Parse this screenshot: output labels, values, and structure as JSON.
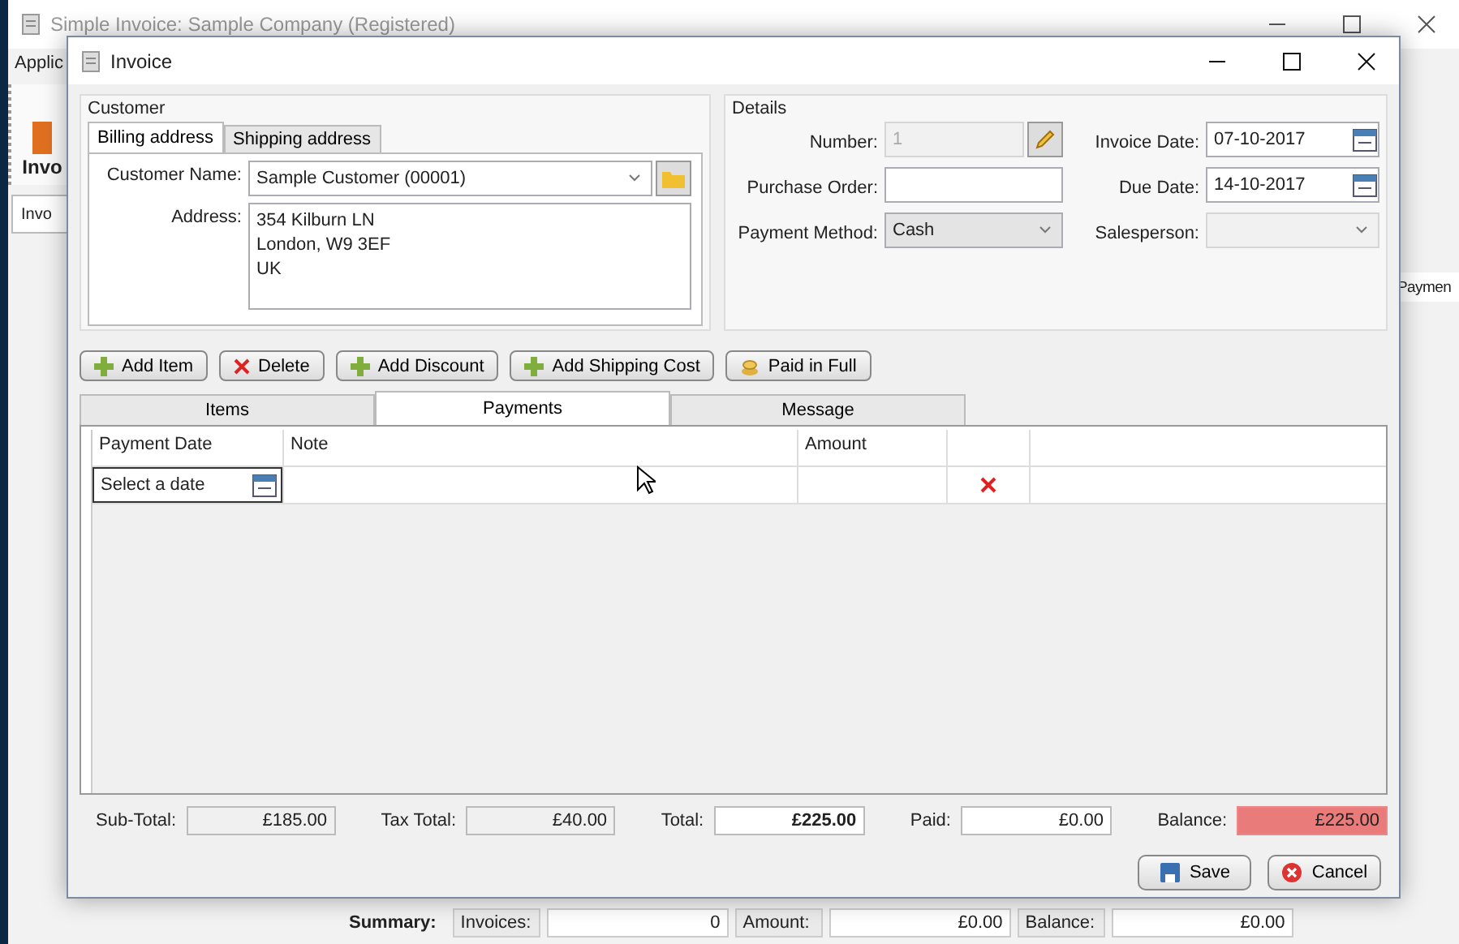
{
  "main_window": {
    "title": "Simple Invoice: Sample Company (Registered)",
    "menu": [
      "Applic"
    ],
    "ribbon_label": "Invo",
    "tab_label": "Invo",
    "side_header": "Paymen",
    "summary": [
      {
        "kind": "heading",
        "text": "Summary:"
      },
      {
        "kind": "label",
        "text": "Invoices:"
      },
      {
        "kind": "value",
        "text": "0"
      },
      {
        "kind": "label",
        "text": "Amount:"
      },
      {
        "kind": "value",
        "text": "£0.00"
      },
      {
        "kind": "label",
        "text": "Balance:"
      },
      {
        "kind": "value",
        "text": "£0.00"
      }
    ]
  },
  "dialog": {
    "title": "Invoice"
  },
  "customer": {
    "title": "Customer",
    "tabs": [
      {
        "label": "Billing address",
        "selected": true
      },
      {
        "label": "Shipping address",
        "selected": false
      }
    ],
    "name_label": "Customer Name:",
    "name_value": "Sample Customer (00001)",
    "address_label": "Address:",
    "address_lines": [
      "354 Kilburn LN",
      "London, W9 3EF",
      "UK"
    ]
  },
  "details": {
    "title": "Details",
    "fields": [
      {
        "label": "Number:",
        "kind": "number",
        "value": "1",
        "disabled": true
      },
      {
        "label": "Invoice Date:",
        "kind": "date",
        "value": "07-10-2017",
        "disabled": false
      },
      {
        "label": "Purchase Order:",
        "kind": "text",
        "disabled": false
      },
      {
        "label": "Due Date:",
        "kind": "date",
        "value": "14-10-2017",
        "disabled": false
      },
      {
        "label": "Payment Method:",
        "kind": "select",
        "value": "Cash",
        "disabled": false
      },
      {
        "label": "Salesperson:",
        "kind": "select",
        "disabled": true
      }
    ]
  },
  "toolbar": [
    {
      "label": "Add Item",
      "kind": "add"
    },
    {
      "label": "Delete",
      "kind": "delete"
    },
    {
      "label": "Add Discount",
      "kind": "add"
    },
    {
      "label": "Add Shipping Cost",
      "kind": "add"
    },
    {
      "label": "Paid in Full",
      "kind": "paid"
    }
  ],
  "tabs": [
    {
      "label": "Items",
      "selected": false
    },
    {
      "label": "Payments",
      "selected": true
    },
    {
      "label": "Message",
      "selected": false
    }
  ],
  "payments": {
    "columns": [
      "Payment Date",
      "Note",
      "Amount"
    ],
    "rows": [
      {
        "date_placeholder": "Select a date"
      }
    ]
  },
  "totals": [
    {
      "label": "Sub-Total:",
      "value": "£185.00",
      "kind": "readonly"
    },
    {
      "label": "Tax Total:",
      "value": "£40.00",
      "kind": "readonly"
    },
    {
      "label": "Total:",
      "value": "£225.00",
      "kind": "strong"
    },
    {
      "label": "Paid:",
      "value": "£0.00",
      "kind": "input"
    },
    {
      "label": "Balance:",
      "value": "£225.00",
      "kind": "alert"
    }
  ],
  "buttons": [
    {
      "label": "Save",
      "kind": "save"
    },
    {
      "label": "Cancel",
      "kind": "cancel"
    }
  ]
}
